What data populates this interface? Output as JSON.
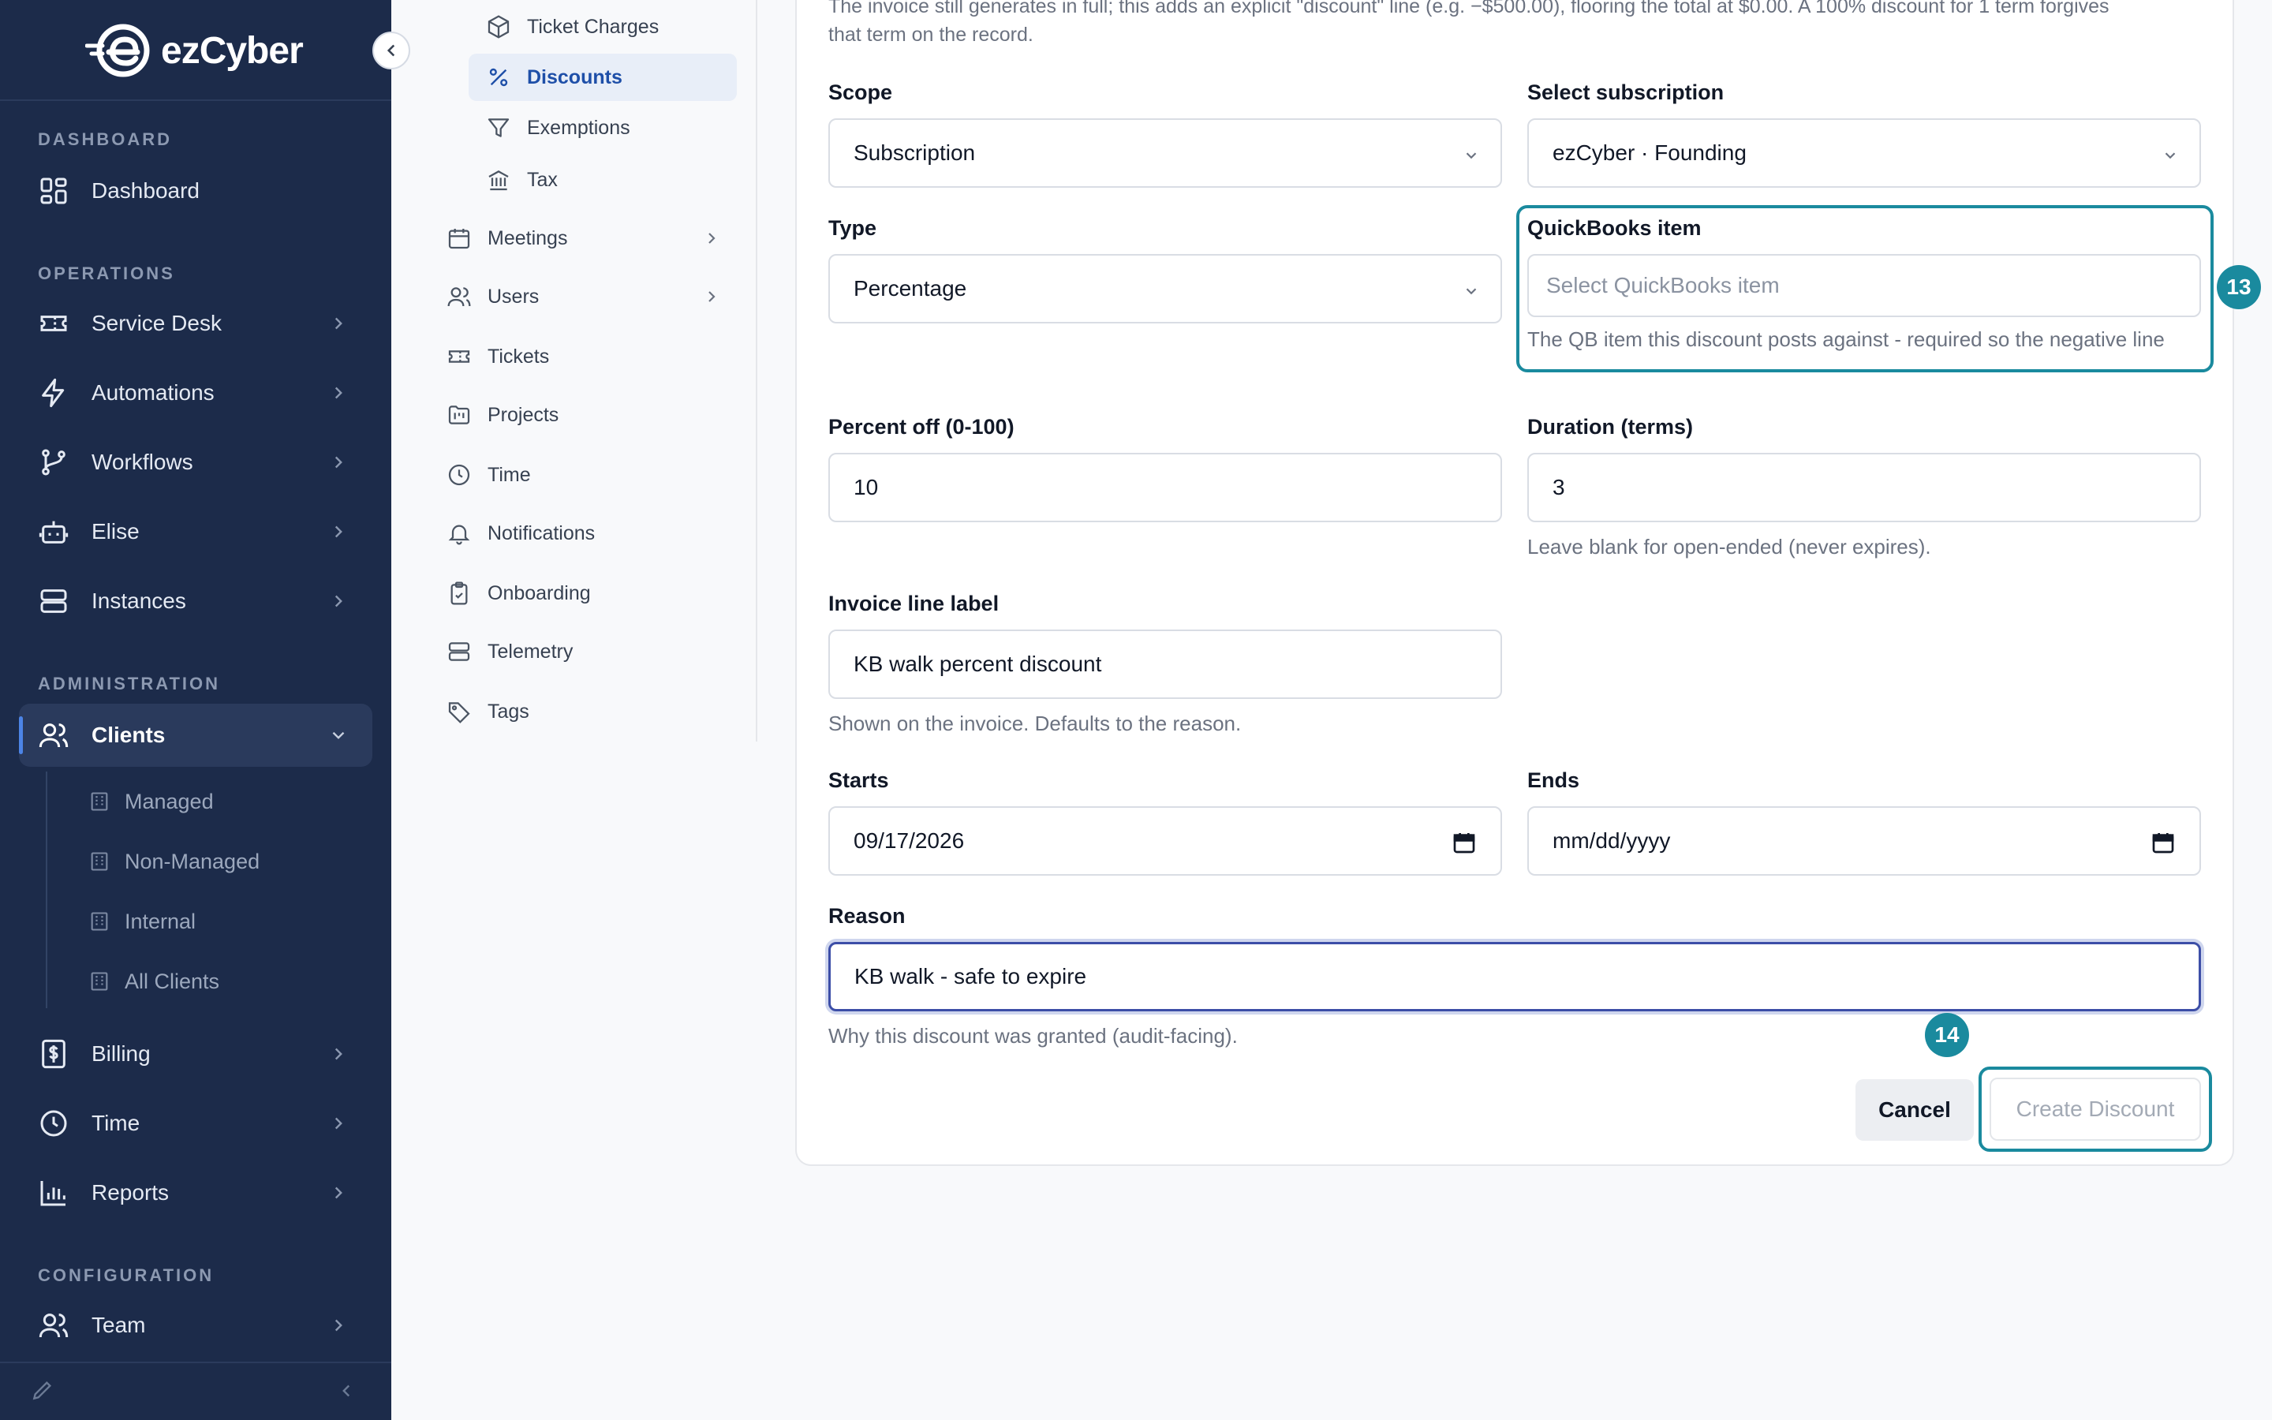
{
  "app": {
    "logo_text": "ezCyber"
  },
  "nav": {
    "sections": {
      "dashboard": "DASHBOARD",
      "operations": "OPERATIONS",
      "administration": "ADMINISTRATION",
      "configuration": "CONFIGURATION"
    },
    "items": {
      "dashboard": "Dashboard",
      "service_desk": "Service Desk",
      "automations": "Automations",
      "workflows": "Workflows",
      "elise": "Elise",
      "instances": "Instances",
      "clients": "Clients",
      "billing": "Billing",
      "time": "Time",
      "reports": "Reports",
      "team": "Team"
    },
    "clients_sub": [
      "Managed",
      "Non-Managed",
      "Internal",
      "All Clients"
    ]
  },
  "subnav": {
    "ticket_charges": "Ticket Charges",
    "discounts": "Discounts",
    "exemptions": "Exemptions",
    "tax": "Tax",
    "meetings": "Meetings",
    "users": "Users",
    "tickets": "Tickets",
    "projects": "Projects",
    "time": "Time",
    "notifications": "Notifications",
    "onboarding": "Onboarding",
    "telemetry": "Telemetry",
    "tags": "Tags"
  },
  "form": {
    "intro_line1": "The invoice still generates in full; this adds an explicit \"discount\" line (e.g. −$500.00), flooring the total at $0.00. A 100% discount for 1 term forgives",
    "intro_line2": "that term on the record.",
    "scope": {
      "label": "Scope",
      "value": "Subscription"
    },
    "subscription": {
      "label": "Select subscription",
      "value": "ezCyber · Founding"
    },
    "type": {
      "label": "Type",
      "value": "Percentage"
    },
    "quickbooks": {
      "label": "QuickBooks item",
      "placeholder": "Select QuickBooks item",
      "hint": "The QB item this discount posts against - required so the negative line posts with a valid item reference."
    },
    "percent_off": {
      "label": "Percent off (0-100)",
      "value": "10"
    },
    "duration": {
      "label": "Duration (terms)",
      "value": "3",
      "hint": "Leave blank for open-ended (never expires)."
    },
    "invoice_label": {
      "label": "Invoice line label",
      "value": "KB walk percent discount",
      "hint": "Shown on the invoice. Defaults to the reason."
    },
    "starts": {
      "label": "Starts",
      "value": "09/17/2026"
    },
    "ends": {
      "label": "Ends",
      "value": "mm/dd/yyyy"
    },
    "reason": {
      "label": "Reason",
      "value": "KB walk - safe to expire",
      "hint": "Why this discount was granted (audit-facing)."
    },
    "cancel_label": "Cancel",
    "create_label": "Create Discount"
  },
  "annotations": {
    "badge_13": "13",
    "badge_14": "14"
  },
  "colors": {
    "nav_bg": "#1c2b4a",
    "accent": "#1a8a9e",
    "focus": "#3c4ea7"
  }
}
